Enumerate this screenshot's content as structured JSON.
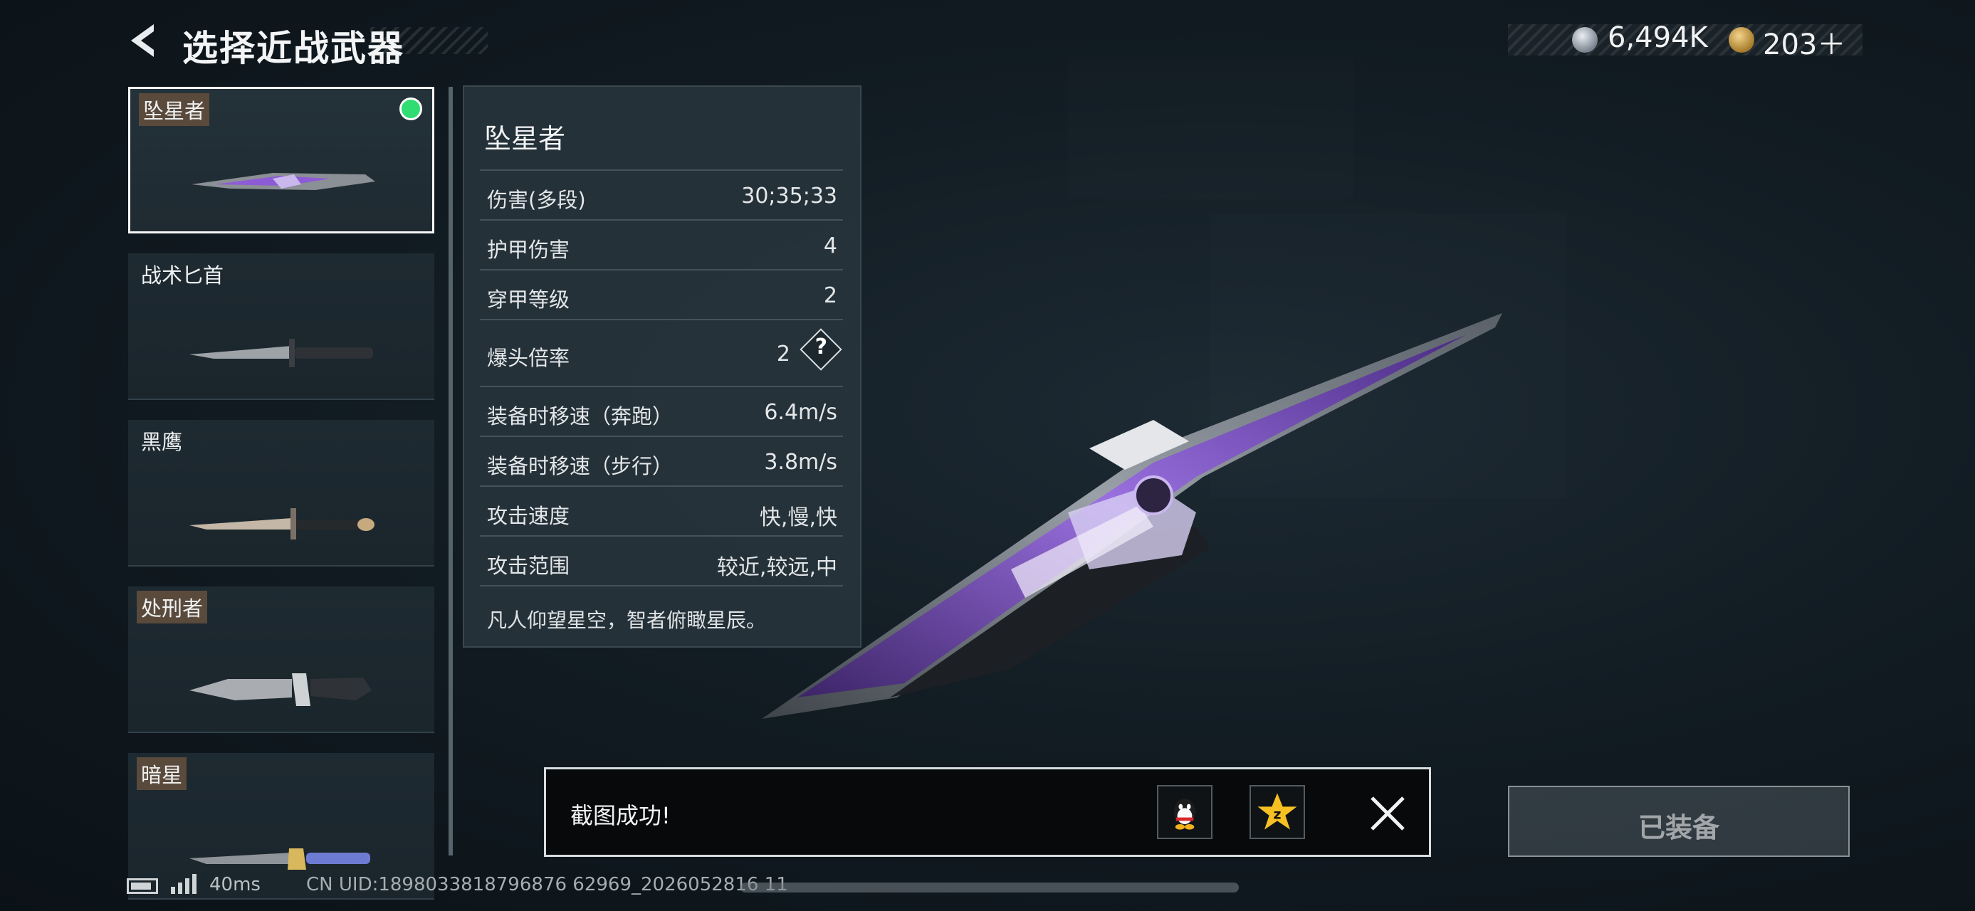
{
  "header": {
    "title": "选择近战武器",
    "currency": {
      "silver_icon": "silver-coin-icon",
      "silver_amount": "6,494K",
      "gold_icon": "gold-coin-icon",
      "gold_amount": "203＋"
    }
  },
  "weapons": [
    {
      "name": "坠星者",
      "selected": true
    },
    {
      "name": "战术匕首",
      "selected": false
    },
    {
      "name": "黑鹰",
      "selected": false
    },
    {
      "name": "处刑者",
      "selected": false
    },
    {
      "name": "暗星",
      "selected": false
    }
  ],
  "stats": {
    "title": "坠星者",
    "rows": [
      {
        "label": "伤害(多段)",
        "value": "30;35;33"
      },
      {
        "label": "护甲伤害",
        "value": "4"
      },
      {
        "label": "穿甲等级",
        "value": "2"
      },
      {
        "label": "爆头倍率",
        "value": "2"
      },
      {
        "label": "装备时移速（奔跑）",
        "value": "6.4m/s"
      },
      {
        "label": "装备时移速（步行）",
        "value": "3.8m/s"
      },
      {
        "label": "攻击速度",
        "value": "快,慢,快"
      },
      {
        "label": "攻击范围",
        "value": "较近,较远,中"
      }
    ],
    "help_glyph": "?",
    "description": "凡人仰望星空，智者俯瞰星辰。"
  },
  "toast": {
    "message": "截图成功!",
    "share_qq_icon": "qq-penguin-icon",
    "share_zone_icon": "qzone-star-icon",
    "close_icon": "close-icon"
  },
  "equip_button": {
    "label": "已装备"
  },
  "status_bar": {
    "ping": "40ms",
    "uid": "CN UID:1898033818796876 62969_2026052816 11"
  },
  "colors": {
    "selected_dot": "#2fdd73",
    "accent_purple": "#8e5bd6",
    "panel_bg": "#28343c"
  }
}
